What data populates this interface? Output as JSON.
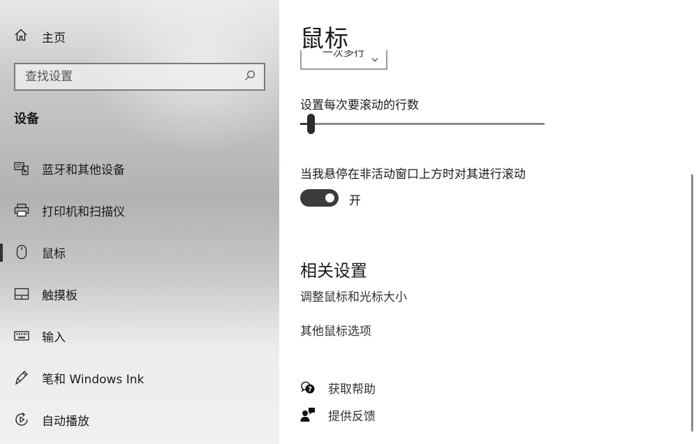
{
  "sidebar": {
    "home_label": "主页",
    "search_placeholder": "查找设置",
    "section_heading": "设备",
    "items": [
      {
        "label": "蓝牙和其他设备",
        "icon": "bluetooth-devices-icon"
      },
      {
        "label": "打印机和扫描仪",
        "icon": "printer-icon"
      },
      {
        "label": "鼠标",
        "icon": "mouse-icon",
        "selected": true
      },
      {
        "label": "触摸板",
        "icon": "touchpad-icon"
      },
      {
        "label": "输入",
        "icon": "keyboard-icon"
      },
      {
        "label": "笔和 Windows Ink",
        "icon": "pen-icon"
      },
      {
        "label": "自动播放",
        "icon": "autoplay-icon"
      }
    ]
  },
  "main": {
    "title": "鼠标",
    "dropdown_value": "一次多行",
    "slider_label": "设置每次要滚动的行数",
    "slider_fraction": 0.03,
    "hover_scroll_label": "当我悬停在非活动窗口上方时对其进行滚动",
    "hover_scroll_on": true,
    "hover_scroll_state": "开",
    "related_heading": "相关设置",
    "related_links": [
      "调整鼠标和光标大小",
      "其他鼠标选项"
    ],
    "help_links": [
      {
        "label": "获取帮助",
        "icon": "help-chat-icon"
      },
      {
        "label": "提供反馈",
        "icon": "feedback-icon"
      }
    ]
  },
  "colors": {
    "accent_dark": "#3b3b3b",
    "text": "#1a1a1a"
  }
}
